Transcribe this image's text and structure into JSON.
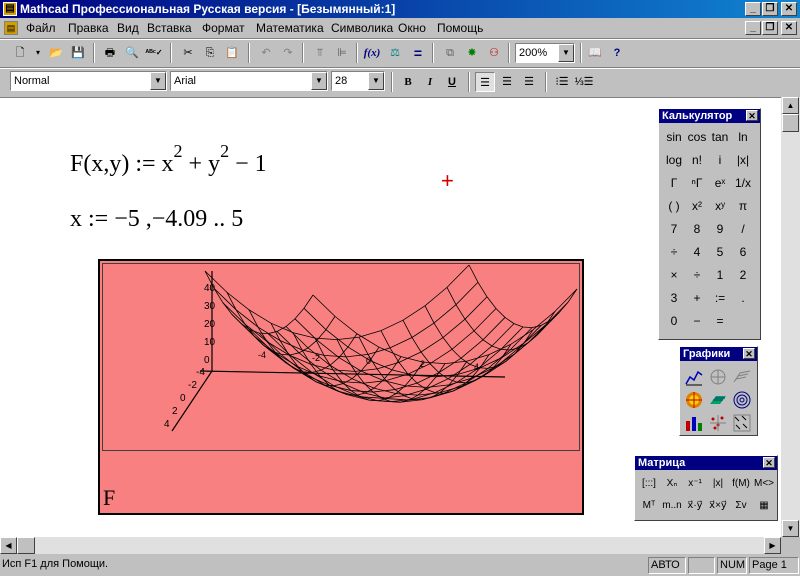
{
  "window": {
    "title": "Mathcad Профессиональная Русская версия - [Безымянный:1]",
    "min": "_",
    "max": "❐",
    "close": "✕"
  },
  "menu": [
    "Файл",
    "Правка",
    "Вид",
    "Вставка",
    "Формат",
    "Математика",
    "Символика",
    "Окно",
    "Помощь"
  ],
  "toolbar": {
    "zoom": "200%",
    "icons": [
      "new-icon",
      "open-icon",
      "save-icon",
      "print-icon",
      "preview-icon",
      "spell-icon",
      "cut-icon",
      "copy-icon",
      "paste-icon",
      "undo-icon",
      "redo-icon",
      "align-top-icon",
      "align-left-icon",
      "insert-function-icon",
      "insert-unit-icon",
      "calculate-icon",
      "component-icon",
      "expert-icon",
      "resource-icon",
      "resource-center-icon",
      "help-icon"
    ],
    "fx": "f(x)",
    "eq": "="
  },
  "format": {
    "style": "Normal",
    "font": "Arial",
    "size": "28",
    "bold": "B",
    "italic": "I",
    "underline": "U"
  },
  "worksheet": {
    "eq1": {
      "lhs": "F(x,y) := x",
      "exp1": "2",
      "mid": " + y",
      "exp2": "2",
      "rhs": " − 1"
    },
    "eq2": "x := −5 ,−4.09 .. 5",
    "plot_label": "F",
    "z_ticks": [
      "40",
      "30",
      "20",
      "10",
      "0"
    ],
    "y_ticks": [
      "-4",
      "-2",
      "0",
      "2",
      "4"
    ],
    "x_ticks": [
      "-4",
      "-2",
      "0",
      "2",
      "4"
    ]
  },
  "calculator": {
    "title": "Калькулятор",
    "keys": [
      [
        "sin",
        "cos",
        "tan",
        "ln"
      ],
      [
        "log",
        "n!",
        "i",
        "|x|"
      ],
      [
        "Γ",
        "ⁿΓ",
        "eˣ",
        "1/x"
      ],
      [
        "( )",
        "x²",
        "xʸ",
        "π"
      ],
      [
        "7",
        "8",
        "9",
        "/"
      ],
      [
        "÷",
        "4",
        "5",
        "6"
      ],
      [
        "×",
        "÷",
        "1",
        "2"
      ],
      [
        "3",
        "+",
        ":=",
        "."
      ],
      [
        "0",
        "−",
        "=",
        ""
      ]
    ]
  },
  "graphs": {
    "title": "Графики"
  },
  "matrix": {
    "title": "Матрица",
    "row1": [
      "[:::]",
      "Xₙ",
      "x⁻¹",
      "|x|",
      "f(M)",
      "M<>"
    ],
    "row2": [
      "Mᵀ",
      "m..n",
      "x⃗·y⃗",
      "x⃗×y⃗",
      "Σv",
      "▦"
    ]
  },
  "status": {
    "help": "Исп F1 для Помощи.",
    "auto": "АВТО",
    "num": "NUM",
    "page": "Page 1"
  },
  "colors": {
    "plot_bg": "#f98080",
    "title_blue": "#000080"
  }
}
